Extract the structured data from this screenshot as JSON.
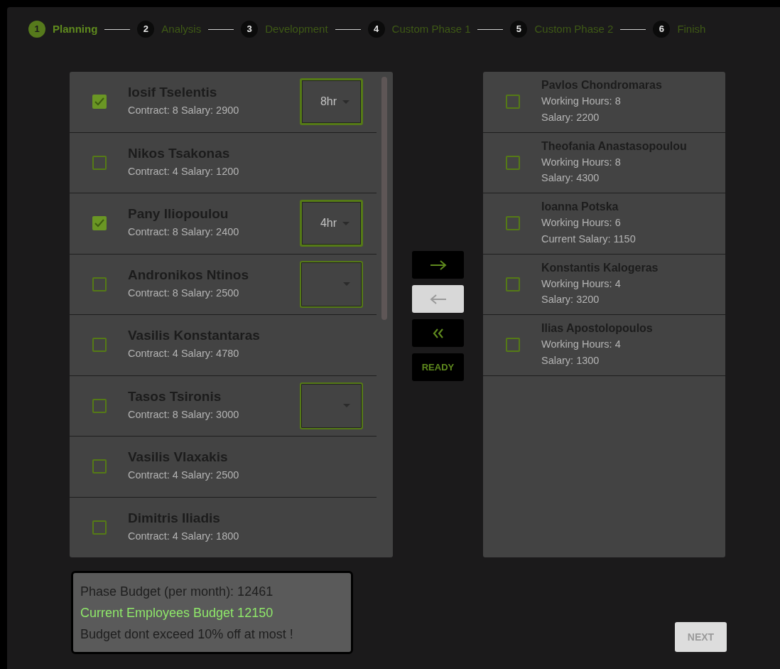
{
  "steps": [
    {
      "number": "1",
      "label": "Planning",
      "selected": true
    },
    {
      "number": "2",
      "label": "Analysis",
      "selected": false
    },
    {
      "number": "3",
      "label": "Development",
      "selected": false
    },
    {
      "number": "4",
      "label": "Custom Phase 1",
      "selected": false
    },
    {
      "number": "5",
      "label": "Custom Phase 2",
      "selected": false
    },
    {
      "number": "6",
      "label": "Finish",
      "selected": false
    }
  ],
  "available_employees": [
    {
      "name": "Iosif Tselentis",
      "details": "Contract: 8 Salary: 2900",
      "checked": true,
      "kind": "with-hours",
      "hours": "8hr"
    },
    {
      "name": "Nikos Tsakonas",
      "details": "Contract: 4 Salary: 1200",
      "checked": false,
      "kind": "plain"
    },
    {
      "name": "Pany Iliopoulou",
      "details": "Contract: 8 Salary: 2400",
      "checked": true,
      "kind": "with-hours",
      "hours": "4hr"
    },
    {
      "name": "Andronikos Ntinos",
      "details": "Contract: 8 Salary: 2500",
      "checked": false,
      "kind": "with-hours"
    },
    {
      "name": "Vasilis Konstantaras",
      "details": "Contract: 4 Salary: 4780",
      "checked": false,
      "kind": "plain"
    },
    {
      "name": "Tasos Tsironis",
      "details": "Contract: 8 Salary: 3000",
      "checked": false,
      "kind": "with-hours"
    },
    {
      "name": "Vasilis Vlaxakis",
      "details": "Contract: 4 Salary: 2500",
      "checked": false,
      "kind": "plain"
    },
    {
      "name": "Dimitris Iliadis",
      "details": "Contract: 4 Salary: 1800",
      "checked": false,
      "kind": "plain"
    }
  ],
  "transfer_buttons": [
    {
      "kind": "move-right",
      "disabled": false
    },
    {
      "kind": "move-left",
      "disabled": true
    },
    {
      "kind": "move-all-left",
      "disabled": false
    },
    {
      "kind": "text",
      "label": "READY",
      "disabled": false
    }
  ],
  "assigned_employees": [
    {
      "name": "Pavlos Chondromaras",
      "hours": "Working Hours: 8",
      "salary": "Salary: 2200",
      "checked": false
    },
    {
      "name": "Theofania Anastasopoulou",
      "hours": "Working Hours: 8",
      "salary": "Salary: 4300",
      "checked": false
    },
    {
      "name": "Ioanna Potska",
      "hours": "Working Hours: 6",
      "salary": "Current Salary: 1150",
      "checked": false
    },
    {
      "name": "Konstantis Kalogeras",
      "hours": "Working Hours: 4",
      "salary": "Salary: 3200",
      "checked": false
    },
    {
      "name": "Ilias Apostolopoulos",
      "hours": "Working Hours: 4",
      "salary": "Salary: 1300",
      "checked": false
    }
  ],
  "budget": [
    {
      "text": "Phase Budget (per month): 12461",
      "kind": "plain"
    },
    {
      "text": "Current Employees Budget 12150",
      "kind": "ok"
    },
    {
      "text": "Budget dont exceed 10% off at most !",
      "kind": "plain"
    }
  ],
  "next_button": {
    "label": "NEXT",
    "disabled": true
  }
}
